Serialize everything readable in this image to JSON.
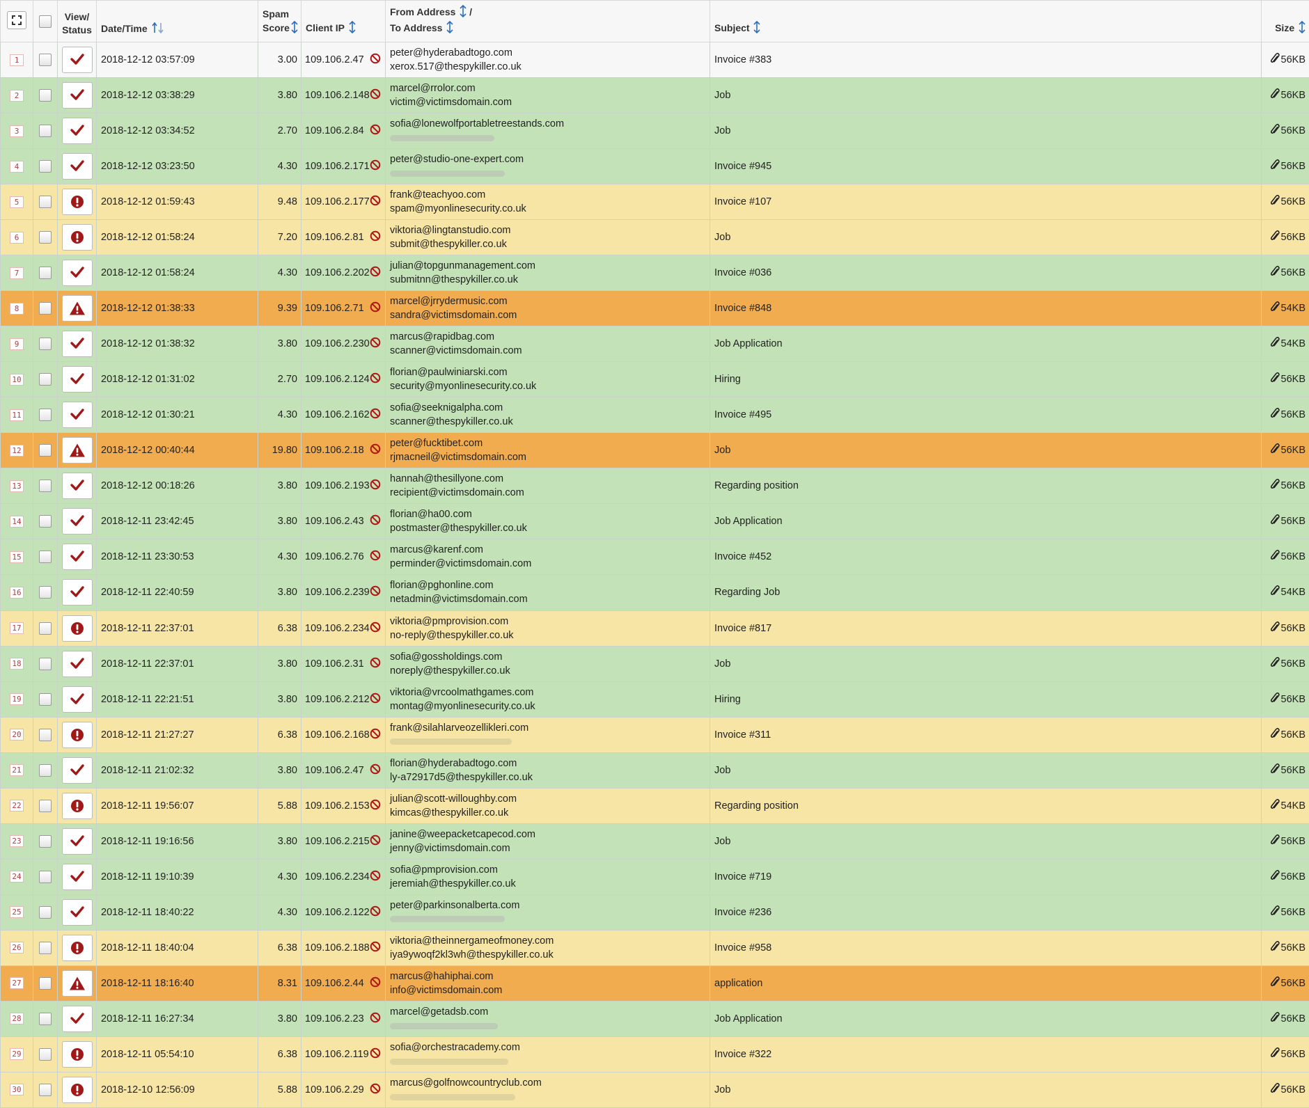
{
  "colors": {
    "ok": "#c4e2b7",
    "warn": "#f7e5a5",
    "high": "#f0ac4e",
    "plain": "#f7f7f7",
    "check": "#a01818",
    "sort_icon": "#2a6fbf"
  },
  "header": {
    "expand_icon": "expand-icon",
    "view_status": [
      "View/",
      "Status"
    ],
    "datetime": "Date/Time",
    "spam_score": [
      "Spam",
      "Score"
    ],
    "client_ip": "Client IP",
    "from_to": [
      "From Address",
      "/",
      "To Address"
    ],
    "subject": "Subject",
    "size": "Size"
  },
  "rows": [
    {
      "n": "1",
      "status": "check",
      "level": "plain",
      "date": "2018-12-12 03:57:09",
      "score": "3.00",
      "ip": "109.106.2.47",
      "from": "peter@hyderabadtogo.com",
      "to": "xerox.517@thespykiller.co.uk",
      "subject": "Invoice #383",
      "size": "56KB"
    },
    {
      "n": "2",
      "status": "check",
      "level": "ok",
      "date": "2018-12-12 03:38:29",
      "score": "3.80",
      "ip": "109.106.2.148",
      "from": "marcel@rrolor.com",
      "to": "victim@victimsdomain.com",
      "subject": "Job",
      "size": "56KB"
    },
    {
      "n": "3",
      "status": "check",
      "level": "ok",
      "date": "2018-12-12 03:34:52",
      "score": "2.70",
      "ip": "109.106.2.84",
      "from": "sofia@lonewolfportabletreestands.com",
      "to": "",
      "subject": "Job",
      "size": "56KB"
    },
    {
      "n": "4",
      "status": "check",
      "level": "ok",
      "date": "2018-12-12 03:23:50",
      "score": "4.30",
      "ip": "109.106.2.171",
      "from": "peter@studio-one-expert.com",
      "to": "",
      "subject": "Invoice #945",
      "size": "56KB"
    },
    {
      "n": "5",
      "status": "alert",
      "level": "warn",
      "date": "2018-12-12 01:59:43",
      "score": "9.48",
      "ip": "109.106.2.177",
      "from": "frank@teachyoo.com",
      "to": "spam@myonlinesecurity.co.uk",
      "subject": "Invoice #107",
      "size": "56KB"
    },
    {
      "n": "6",
      "status": "alert",
      "level": "warn",
      "date": "2018-12-12 01:58:24",
      "score": "7.20",
      "ip": "109.106.2.81",
      "from": "viktoria@lingtanstudio.com",
      "to": "submit@thespykiller.co.uk",
      "subject": "Job",
      "size": "56KB"
    },
    {
      "n": "7",
      "status": "check",
      "level": "ok",
      "date": "2018-12-12 01:58:24",
      "score": "4.30",
      "ip": "109.106.2.202",
      "from": "julian@topgunmanagement.com",
      "to": "submitnn@thespykiller.co.uk",
      "subject": "Invoice #036",
      "size": "56KB"
    },
    {
      "n": "8",
      "status": "warning",
      "level": "high",
      "date": "2018-12-12 01:38:33",
      "score": "9.39",
      "ip": "109.106.2.71",
      "from": "marcel@jrrydermusic.com",
      "to": "sandra@victimsdomain.com",
      "subject": "Invoice #848",
      "size": "54KB"
    },
    {
      "n": "9",
      "status": "check",
      "level": "ok",
      "date": "2018-12-12 01:38:32",
      "score": "3.80",
      "ip": "109.106.2.230",
      "from": "marcus@rapidbag.com",
      "to": "scanner@victimsdomain.com",
      "subject": "Job Application",
      "size": "54KB"
    },
    {
      "n": "10",
      "status": "check",
      "level": "ok",
      "date": "2018-12-12 01:31:02",
      "score": "2.70",
      "ip": "109.106.2.124",
      "from": "florian@paulwiniarski.com",
      "to": "security@myonlinesecurity.co.uk",
      "subject": "Hiring",
      "size": "56KB"
    },
    {
      "n": "11",
      "status": "check",
      "level": "ok",
      "date": "2018-12-12 01:30:21",
      "score": "4.30",
      "ip": "109.106.2.162",
      "from": "sofia@seeknigalpha.com",
      "to": "scanner@thespykiller.co.uk",
      "subject": "Invoice #495",
      "size": "56KB"
    },
    {
      "n": "12",
      "status": "warning",
      "level": "high",
      "date": "2018-12-12 00:40:44",
      "score": "19.80",
      "ip": "109.106.2.18",
      "from": "peter@fucktibet.com",
      "to": "rjmacneil@victimsdomain.com",
      "subject": "Job",
      "size": "56KB"
    },
    {
      "n": "13",
      "status": "check",
      "level": "ok",
      "date": "2018-12-12 00:18:26",
      "score": "3.80",
      "ip": "109.106.2.193",
      "from": "hannah@thesillyone.com",
      "to": "recipient@victimsdomain.com",
      "subject": "Regarding position",
      "size": "56KB"
    },
    {
      "n": "14",
      "status": "check",
      "level": "ok",
      "date": "2018-12-11 23:42:45",
      "score": "3.80",
      "ip": "109.106.2.43",
      "from": "florian@ha00.com",
      "to": "postmaster@thespykiller.co.uk",
      "subject": "Job Application",
      "size": "56KB"
    },
    {
      "n": "15",
      "status": "check",
      "level": "ok",
      "date": "2018-12-11 23:30:53",
      "score": "4.30",
      "ip": "109.106.2.76",
      "from": "marcus@karenf.com",
      "to": "perminder@victimsdomain.com",
      "subject": "Invoice #452",
      "size": "56KB"
    },
    {
      "n": "16",
      "status": "check",
      "level": "ok",
      "date": "2018-12-11 22:40:59",
      "score": "3.80",
      "ip": "109.106.2.239",
      "from": "florian@pghonline.com",
      "to": "netadmin@victimsdomain.com",
      "subject": "Regarding Job",
      "size": "54KB"
    },
    {
      "n": "17",
      "status": "alert",
      "level": "warn",
      "date": "2018-12-11 22:37:01",
      "score": "6.38",
      "ip": "109.106.2.234",
      "from": "viktoria@pmprovision.com",
      "to": "no-reply@thespykiller.co.uk",
      "subject": "Invoice #817",
      "size": "56KB"
    },
    {
      "n": "18",
      "status": "check",
      "level": "ok",
      "date": "2018-12-11 22:37:01",
      "score": "3.80",
      "ip": "109.106.2.31",
      "from": "sofia@gossholdings.com",
      "to": "noreply@thespykiller.co.uk",
      "subject": "Job",
      "size": "56KB"
    },
    {
      "n": "19",
      "status": "check",
      "level": "ok",
      "date": "2018-12-11 22:21:51",
      "score": "3.80",
      "ip": "109.106.2.212",
      "from": "viktoria@vrcoolmathgames.com",
      "to": "montag@myonlinesecurity.co.uk",
      "subject": "Hiring",
      "size": "56KB"
    },
    {
      "n": "20",
      "status": "alert",
      "level": "warn",
      "date": "2018-12-11 21:27:27",
      "score": "6.38",
      "ip": "109.106.2.168",
      "from": "frank@silahlarveozellikleri.com",
      "to": "",
      "subject": "Invoice #311",
      "size": "56KB"
    },
    {
      "n": "21",
      "status": "check",
      "level": "ok",
      "date": "2018-12-11 21:02:32",
      "score": "3.80",
      "ip": "109.106.2.47",
      "from": "florian@hyderabadtogo.com",
      "to": "ly-a72917d5@thespykiller.co.uk",
      "subject": "Job",
      "size": "56KB"
    },
    {
      "n": "22",
      "status": "alert",
      "level": "warn",
      "date": "2018-12-11 19:56:07",
      "score": "5.88",
      "ip": "109.106.2.153",
      "from": "julian@scott-willoughby.com",
      "to": "kimcas@thespykiller.co.uk",
      "subject": "Regarding position",
      "size": "54KB"
    },
    {
      "n": "23",
      "status": "check",
      "level": "ok",
      "date": "2018-12-11 19:16:56",
      "score": "3.80",
      "ip": "109.106.2.215",
      "from": "janine@weepacketcapecod.com",
      "to": "jenny@victimsdomain.com",
      "subject": "Job",
      "size": "56KB"
    },
    {
      "n": "24",
      "status": "check",
      "level": "ok",
      "date": "2018-12-11 19:10:39",
      "score": "4.30",
      "ip": "109.106.2.234",
      "from": "sofia@pmprovision.com",
      "to": "jeremiah@thespykiller.co.uk",
      "subject": "Invoice #719",
      "size": "56KB"
    },
    {
      "n": "25",
      "status": "check",
      "level": "ok",
      "date": "2018-12-11 18:40:22",
      "score": "4.30",
      "ip": "109.106.2.122",
      "from": "peter@parkinsonalberta.com",
      "to": "",
      "subject": "Invoice #236",
      "size": "56KB"
    },
    {
      "n": "26",
      "status": "alert",
      "level": "warn",
      "date": "2018-12-11 18:40:04",
      "score": "6.38",
      "ip": "109.106.2.188",
      "from": "viktoria@theinnergameofmoney.com",
      "to": "iya9ywoqf2kl3wh@thespykiller.co.uk",
      "subject": "Invoice #958",
      "size": "56KB"
    },
    {
      "n": "27",
      "status": "warning",
      "level": "high",
      "date": "2018-12-11 18:16:40",
      "score": "8.31",
      "ip": "109.106.2.44",
      "from": "marcus@hahiphai.com",
      "to": "info@victimsdomain.com",
      "subject": "application",
      "size": "56KB"
    },
    {
      "n": "28",
      "status": "check",
      "level": "ok",
      "date": "2018-12-11 16:27:34",
      "score": "3.80",
      "ip": "109.106.2.23",
      "from": "marcel@getadsb.com",
      "to": "",
      "subject": "Job Application",
      "size": "56KB"
    },
    {
      "n": "29",
      "status": "alert",
      "level": "warn",
      "date": "2018-12-11 05:54:10",
      "score": "6.38",
      "ip": "109.106.2.119",
      "from": "sofia@orchestracademy.com",
      "to": "",
      "subject": "Invoice #322",
      "size": "56KB"
    },
    {
      "n": "30",
      "status": "alert",
      "level": "warn",
      "date": "2018-12-10 12:56:09",
      "score": "5.88",
      "ip": "109.106.2.29",
      "from": "marcus@golfnowcountryclub.com",
      "to": "",
      "subject": "Job",
      "size": "56KB"
    }
  ]
}
